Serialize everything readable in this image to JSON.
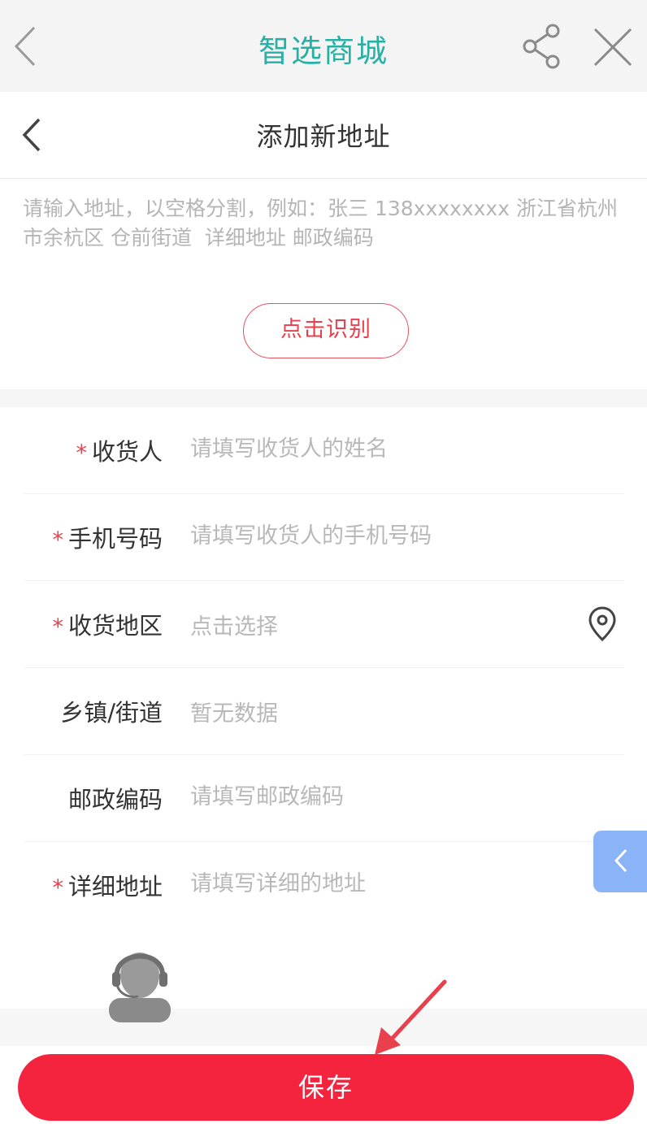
{
  "app_bar": {
    "title": "智选商城"
  },
  "page_header": {
    "title": "添加新地址"
  },
  "smart_paste": {
    "placeholder": "请输入地址，以空格分割，例如：张三 138xxxxxxxx 浙江省杭州市余杭区 仓前街道  详细地址 邮政编码",
    "recognize_label": "点击识别"
  },
  "form": {
    "recipient": {
      "required_mark": "*",
      "label": "收货人",
      "placeholder": "请填写收货人的姓名"
    },
    "phone": {
      "required_mark": "*",
      "label": "手机号码",
      "placeholder": "请填写收货人的手机号码"
    },
    "region": {
      "required_mark": "*",
      "label": "收货地区",
      "value": "点击选择"
    },
    "street": {
      "label": "乡镇/街道",
      "value": "暂无数据"
    },
    "postal": {
      "label": "邮政编码",
      "placeholder": "请填写邮政编码"
    },
    "detail": {
      "required_mark": "*",
      "label": "详细地址",
      "placeholder": "请填写详细的地址"
    }
  },
  "save_label": "保存",
  "colors": {
    "accent": "#f4243f",
    "title": "#26b0a6",
    "side_button": "#8bb3f7"
  }
}
